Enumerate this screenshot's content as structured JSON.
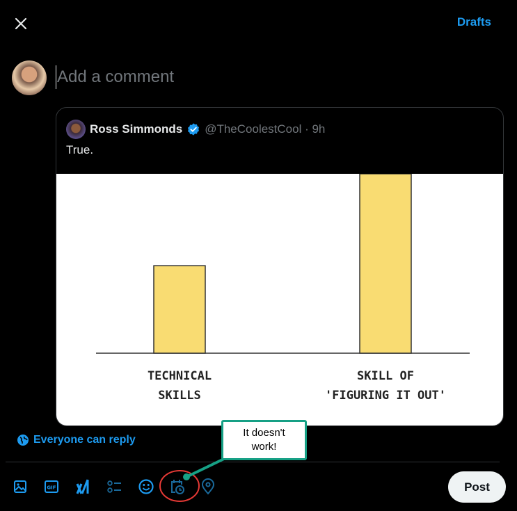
{
  "header": {
    "close_icon": "close-icon",
    "drafts_label": "Drafts"
  },
  "composer": {
    "placeholder": "Add a comment"
  },
  "quoted_post": {
    "author_name": "Ross Simmonds",
    "verified": true,
    "handle_time": "@TheCoolestCool · 9h",
    "text": "True."
  },
  "chart_data": {
    "type": "bar",
    "title": "",
    "xlabel": "",
    "ylabel": "",
    "categories": [
      "TECHNICAL SKILLS",
      "SKILL OF 'FIGURING IT OUT'"
    ],
    "category_lines": [
      [
        "TECHNICAL",
        "SKILLS"
      ],
      [
        "SKILL OF",
        "'FIGURING IT OUT'"
      ]
    ],
    "values": [
      1,
      2.05
    ],
    "ylim": [
      0,
      2.05
    ],
    "grid": false,
    "bar_color": "#f9dc72",
    "note": "Values are relative (no axis); right bar extends beyond the visible crop"
  },
  "reply_setting": {
    "icon": "globe-icon",
    "label": "Everyone can reply"
  },
  "toolbar": {
    "tools": [
      {
        "name": "media-icon"
      },
      {
        "name": "gif-icon"
      },
      {
        "name": "grok-icon"
      },
      {
        "name": "poll-icon"
      },
      {
        "name": "emoji-icon"
      },
      {
        "name": "schedule-icon"
      },
      {
        "name": "location-icon"
      }
    ],
    "post_label": "Post"
  },
  "annotation": {
    "callout_text_line1": "It doesn't",
    "callout_text_line2": "work!",
    "callout_color": "#16a085",
    "circle_color": "#e53935"
  }
}
